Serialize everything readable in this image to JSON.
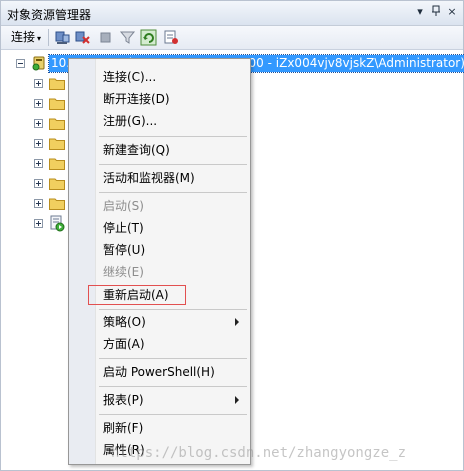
{
  "panel": {
    "title": "对象资源管理器",
    "controls": {
      "dropdown": "▾",
      "pin": "ꟷ",
      "close": "×"
    }
  },
  "toolbar": {
    "connect_label": "连接",
    "connect_caret": "▾",
    "icons": [
      "connect-object-icon",
      "disconnect-icon",
      "stop-icon",
      "filter-icon",
      "refresh-icon",
      "new-query-icon"
    ]
  },
  "tree": {
    "server_label": "10.25.79.73 (SQL Server 12.0.2000 - iZx004vjv8vjskZ\\Administrator)",
    "child_count": 8
  },
  "context_menu": {
    "items": [
      {
        "label": "连接(C)...",
        "enabled": true
      },
      {
        "label": "断开连接(D)",
        "enabled": true
      },
      {
        "label": "注册(G)...",
        "enabled": true
      },
      {
        "label": "新建查询(Q)",
        "enabled": true
      },
      {
        "label": "活动和监视器(M)",
        "enabled": true
      },
      {
        "label": "启动(S)",
        "enabled": false
      },
      {
        "label": "停止(T)",
        "enabled": true
      },
      {
        "label": "暂停(U)",
        "enabled": true
      },
      {
        "label": "继续(E)",
        "enabled": false
      },
      {
        "label": "重新启动(A)",
        "enabled": true,
        "highlighted": true
      },
      {
        "label": "策略(O)",
        "enabled": true,
        "submenu": true
      },
      {
        "label": "方面(A)",
        "enabled": true
      },
      {
        "label": "启动 PowerShell(H)",
        "enabled": true
      },
      {
        "label": "报表(P)",
        "enabled": true,
        "submenu": true
      },
      {
        "label": "刷新(F)",
        "enabled": true
      },
      {
        "label": "属性(R)",
        "enabled": true
      }
    ]
  },
  "watermark": "https://blog.csdn.net/zhangyongze_z",
  "colors": {
    "selection": "#3399ff",
    "highlight_box": "#e25050"
  }
}
